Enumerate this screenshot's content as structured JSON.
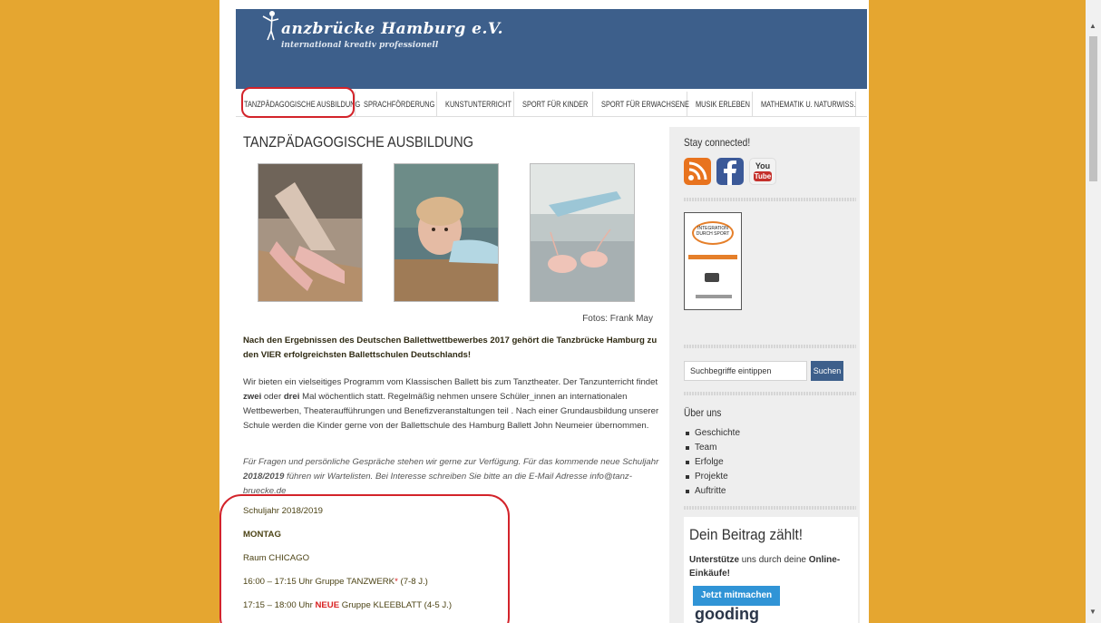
{
  "site": {
    "title": "anzbrücke Hamburg e.V.",
    "tagline": "international kreativ professionell"
  },
  "nav": {
    "items": [
      {
        "label": "Tanzpädagogische Ausbildung"
      },
      {
        "label": "Sprachförderung"
      },
      {
        "label": "Kunstunterricht"
      },
      {
        "label": "Sport für Kinder"
      },
      {
        "label": "Sport für Erwachsene"
      },
      {
        "label": "Musik erleben"
      },
      {
        "label": "Mathematik u. Naturwiss."
      }
    ]
  },
  "main": {
    "title": "TANZPÄDAGOGISCHE AUSBILDUNG",
    "photo_credit": "Fotos: Frank May",
    "intro_bold": "Nach den Ergebnissen des Deutschen Ballettwettbewerbes 2017 gehört die Tanzbrücke Hamburg zu den VIER erfolgreichsten Ballettschulen Deutschlands!",
    "para1_a": "Wir bieten ein vielseitiges Programm vom Klassischen Ballett bis zum Tanztheater. Der Tanzunterricht findet ",
    "para1_b": "zwei",
    "para1_c": " oder ",
    "para1_d": "drei",
    "para1_e": " Mal wöchentlich statt. Regelmäßig nehmen unsere Schüler_innen an internationalen Wettbewerben, Theateraufführungen und Benefizveranstaltungen teil . Nach einer Grundausbildung unserer Schule werden die Kinder gerne von der Ballettschule des Hamburg Ballett John Neumeier übernommen.",
    "para2_a": "Für Fragen und persönliche Gespräche stehen wir gerne zur Verfügung. Für das kommende neue Schuljahr ",
    "para2_b": "2018/2019",
    "para2_c": "  führen wir Wartelisten. Bei Interesse schreiben Sie bitte an die E-Mail Adresse info@tanz-bruecke.de",
    "schedule": {
      "school_year": "Schuljahr 2018/2019",
      "day": "MONTAG",
      "room_label": "Raum ",
      "room_name": "CHICAGO",
      "slot1_time": "16:00 – 17:15 Uhr Gruppe TANZWERK",
      "slot1_star": "*",
      "slot1_age": " (7-8 J.)",
      "slot2_time": "17:15 – 18:00 Uhr ",
      "slot2_new": "NEUE",
      "slot2_rest": " Gruppe KLEEBLATT (4-5 J.)"
    }
  },
  "sidebar": {
    "stay_connected": "Stay connected!",
    "social": [
      {
        "icon": "rss-icon",
        "color": "#e8731e"
      },
      {
        "icon": "facebook-icon",
        "color": "#3b5998"
      },
      {
        "icon": "youtube-icon",
        "color": "#c4302b",
        "label_top": "You",
        "label_bottom": "Tube"
      }
    ],
    "badge": {
      "line1": "INTEGRATION",
      "line2": "DURCH SPORT"
    },
    "search_placeholder": "Suchbegriffe eintippen",
    "search_button": "Suchen",
    "about_title": "Über uns",
    "about_items": [
      "Geschichte",
      "Team",
      "Erfolge",
      "Projekte",
      "Auftritte"
    ],
    "donate_title": "Dein Beitrag zählt!",
    "donate_text_a": "Unterstütze",
    "donate_text_b": " uns durch deine ",
    "donate_text_c": "Online-Einkäufe!",
    "donate_button": "Jetzt mitmachen",
    "gooding_logo": "gooding"
  },
  "colors": {
    "background": "#e5a630",
    "header": "#3d5f8b",
    "highlight": "#d3232a",
    "accent_red": "#d82020"
  }
}
